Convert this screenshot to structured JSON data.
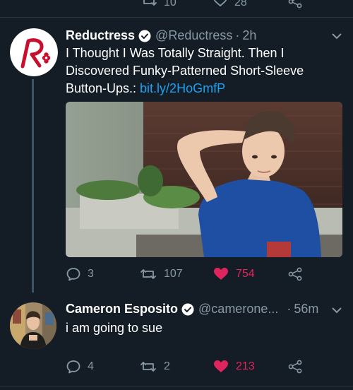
{
  "previous_tweet": {
    "actions": {
      "retweets": "10",
      "likes": "28"
    }
  },
  "tweet1": {
    "name": "Reductress",
    "handle": "@Reductress",
    "separator": "·",
    "time": "2h",
    "text_before_link": "I Thought I Was Totally Straight. Then I Discovered Funky-Patterned Short-Sleeve Button-Ups.: ",
    "link": "bit.ly/2HoGmfP",
    "actions": {
      "replies": "3",
      "retweets": "107",
      "likes": "754"
    }
  },
  "tweet2": {
    "name": "Cameron Esposito",
    "handle": "@camerone...",
    "separator": "·",
    "time": "56m",
    "text": "i am going to sue",
    "actions": {
      "replies": "4",
      "retweets": "2",
      "likes": "213"
    }
  },
  "colors": {
    "background": "#141d26",
    "secondary_text": "#8899a6",
    "link": "#1da1f2",
    "like": "#e0245e",
    "brand_red": "#c8102e"
  },
  "icons": [
    "reply-icon",
    "retweet-icon",
    "heart-icon",
    "share-icon",
    "verified-icon",
    "chevron-down-icon"
  ]
}
